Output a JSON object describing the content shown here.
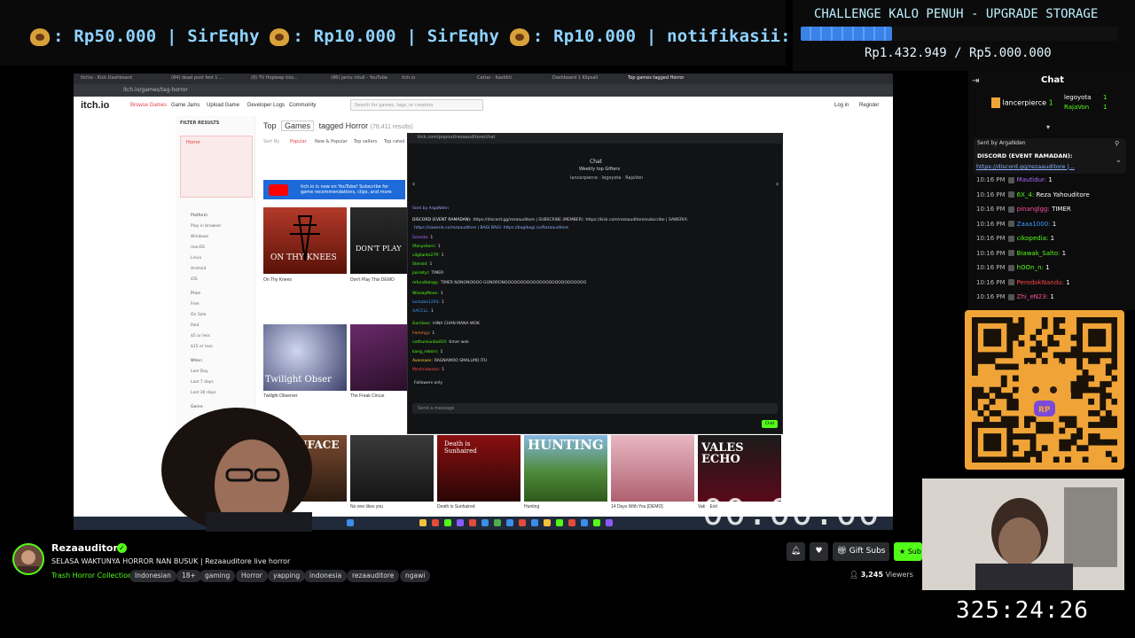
{
  "ticker": {
    "text": "Rp50.000 | SirEqhy  : Rp10.000 | SirEqhy  : Rp10.000 | notifikasii:",
    "segments": [
      {
        "amount": ": Rp50.000 | SirEqhy"
      },
      {
        "amount": ": Rp10.000 | SirEqhy"
      },
      {
        "amount": ": Rp10.000 | notifikasii:"
      }
    ]
  },
  "challenge": {
    "title": "CHALLENGE KALO PENUH - UPGRADE STORAGE",
    "progress_text": "Rp1.432.949 / Rp5.000.000",
    "progress_fraction": 0.287,
    "bar_color": "#3b82e6"
  },
  "browser": {
    "url": "itch.io/games/tag-horror",
    "tabs": [
      "Itchio - Kick Dashboard",
      "(84) dead post fest 1 ...",
      "(8) TV Hopleep tiko...",
      "(86) jantu intuli - YouTube",
      "itch.io",
      "Cattar - Kastiliti",
      "Dashboard 1 Klipsali",
      "Top games tagged Horror"
    ]
  },
  "itch": {
    "logo": "itch.io",
    "nav": [
      "Browse Games",
      "Game Jams",
      "Upload Game",
      "Developer Logs",
      "Community"
    ],
    "search_placeholder": "Search for games, tags, or creators",
    "login": "Log in",
    "register": "Register",
    "filter_title": "FILTER RESULTS",
    "filter_tag": "Horror",
    "filter_options": [
      "Platform",
      "Play in browser",
      "Windows",
      "macOS",
      "Linux",
      "Android",
      "iOS",
      "Price",
      "Free",
      "On Sale",
      "Paid",
      "$5 or less",
      "$15 or less",
      "When",
      "Last Day",
      "Last 7 days",
      "Last 30 days",
      "Genre"
    ],
    "heading_top": "Top",
    "heading_games": "Games",
    "heading_tagged": "tagged Horror",
    "heading_count": "(78,411 results)",
    "sort_options": [
      "Sort By",
      "Popular",
      "New & Popular",
      "Top sellers",
      "Top rated"
    ],
    "yt_banner": "itch.io is now on YouTube! Subscribe for game recommendations, clips, and more",
    "games": [
      {
        "name": "On Thy Knees",
        "caption": "ON THY KNEES"
      },
      {
        "name": "Don't Play This DEMO",
        "caption": "DON'T PLAY"
      },
      {
        "name": "Twilight Observer",
        "caption": "Twilight Obser"
      },
      {
        "name": "The Freak Circus",
        "caption": ""
      },
      {
        "name": "",
        "caption": "SKINFACE"
      },
      {
        "name": "No one likes you",
        "caption": ""
      },
      {
        "name": "Death is Sunhaired",
        "caption": "Death is Sunhaired"
      },
      {
        "name": "Hunting",
        "caption": "HUNTING"
      },
      {
        "name": "14 Days With You [DEMO]",
        "caption": ""
      },
      {
        "name": "Vak ↓ Exit",
        "caption": "VALES ECHO"
      }
    ]
  },
  "kick_window": {
    "url": "kick.com/popout/rezaauditore/chat",
    "title": "Chat",
    "gifters_title": "Weekly top Gifters",
    "gifters": "lancerpierce · legoyota · RajaVon",
    "lines": [
      {
        "user": "Sent by ArgaNden",
        "text": "",
        "color": "#a0a0ff"
      },
      {
        "user": "DISCORD (EVENT RAMADAN):",
        "text": "https://discord.gg/rezaauditore | SUBSCRIBE (MEMBER): https://kick.com/rezaauditore/subscribe | SAWERIA:",
        "color": "#ffffff"
      },
      {
        "user": "",
        "text": "https://saweria.co/rezaauditore | BAGI BAGI: https://bagibagi.co/Rezaauditore",
        "color": "#8ab4ff"
      },
      {
        "user": "Sonoda:",
        "text": "1",
        "color": "#b06dff"
      },
      {
        "user": "iflanysherri:",
        "text": "1",
        "color": "#53fc18"
      },
      {
        "user": "vilgilante27P:",
        "text": "1",
        "color": "#53fc18"
      },
      {
        "user": "Steroid:",
        "text": "1",
        "color": "#53fc18"
      },
      {
        "user": "jasiretyl:",
        "text": "TIMER",
        "color": "#53fc18"
      },
      {
        "user": "refundtology:",
        "text": "TIMER NONONOOOO GONORONOOOOOOOOOOOOOOOOOOOOOOOOOO",
        "color": "#53fc18"
      },
      {
        "user": "WiseayMoon:",
        "text": "1",
        "color": "#53fc18"
      },
      {
        "user": "lactuble1293:",
        "text": "1",
        "color": "#3c9cff"
      },
      {
        "user": "AACCLL:",
        "text": "1",
        "color": "#3c9cff"
      },
      {
        "user": "Gorillaxs:",
        "text": "HINA CHAN MANA WOK",
        "color": "#53fc18"
      },
      {
        "user": "Femmyy:",
        "text": "1",
        "color": "#ff8c3c"
      },
      {
        "user": "nathunsunbail10:",
        "text": "timer wok",
        "color": "#53fc18"
      },
      {
        "user": "kang_reborn:",
        "text": "1",
        "color": "#53fc18"
      },
      {
        "user": "Avensaes:",
        "text": "RAGNAMOO SMALLMO ITU",
        "color": "#ffd23c"
      },
      {
        "user": "Meshriawaan:",
        "text": "1",
        "color": "#ff4747"
      },
      {
        "user": "",
        "text": "Followers only",
        "color": "#aaaaaa"
      }
    ],
    "input_placeholder": "Send a message",
    "chat_button": "Chat"
  },
  "screen_timer": "00:00:00",
  "chat_panel": {
    "title": "Chat",
    "gifter_1": "lancerpierce",
    "gifter_1_count": "1",
    "gifter_2": "legoyota",
    "gifter_2_count": "1",
    "gifter_3": "RajaVon",
    "gifter_3_count": "1",
    "pinned_by": "Sent by ArgaNden",
    "pinned_msg": "DISCORD (EVENT RAMADAN):",
    "pinned_link": "https://discord.gg/rezaauditore |...",
    "messages": [
      {
        "time": "10:16 PM",
        "user": "Mautidur:",
        "text": " 1",
        "color": "#b06dff"
      },
      {
        "time": "10:16 PM",
        "user": "6X_4:",
        "text": " Reza Yahouditore",
        "color": "#53fc18"
      },
      {
        "time": "10:16 PM",
        "user": "pinanglgg:",
        "text": " TIMER",
        "color": "#ff4fa3"
      },
      {
        "time": "10:16 PM",
        "user": "Zaaa1000:",
        "text": " 1",
        "color": "#3c9cff"
      },
      {
        "time": "10:16 PM",
        "user": "cikopedia:",
        "text": " 1",
        "color": "#53fc18"
      },
      {
        "time": "10:16 PM",
        "user": "Biawak_Salto:",
        "text": " 1",
        "color": "#53fc18"
      },
      {
        "time": "10:16 PM",
        "user": "hOOn_n:",
        "text": " 1",
        "color": "#53fc18"
      },
      {
        "time": "10:16 PM",
        "user": "PerodokNandu:",
        "text": " 1",
        "color": "#ff4747"
      },
      {
        "time": "10:16 PM",
        "user": "Zhi_eN23:",
        "text": " 1",
        "color": "#ff4fa3"
      }
    ]
  },
  "qr": {
    "badge": "RP",
    "color": "#f0a437"
  },
  "channel": {
    "name": "Rezaauditore",
    "title": "SELASA WAKTUNYA HORROR NAN BUSUK | Rezaauditore live horror",
    "category": "Trash Horror Collection",
    "tags": [
      "Indonesian",
      "18+",
      "gaming",
      "Horror",
      "yapping",
      "indonesia",
      "rezaauditore",
      "ngawi"
    ],
    "viewers": "3,245",
    "viewers_label": "Viewers",
    "gift_subs": "Gift Subs",
    "subscribe": "Sub",
    "accent": "#53fc18"
  },
  "uptime": "325:24:26"
}
